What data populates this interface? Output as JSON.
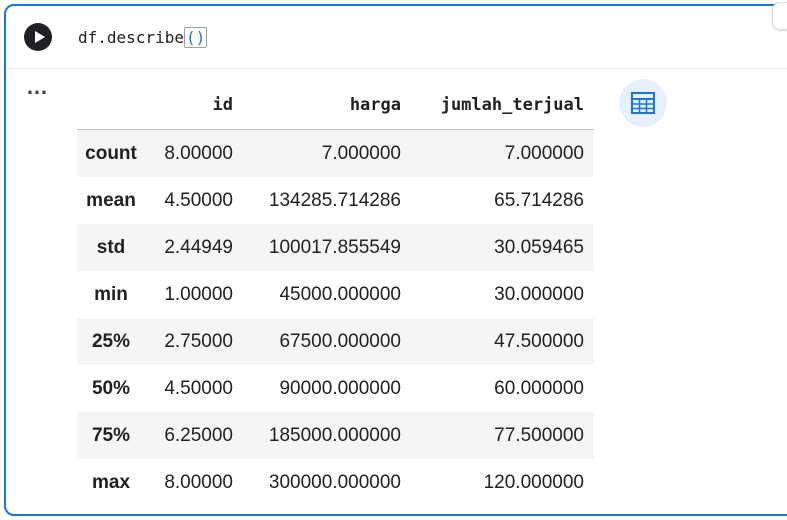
{
  "code_cell": {
    "code_prefix": "df.describe",
    "code_parens": "()",
    "run_icon": "play-icon",
    "output_menu_icon": "more-horiz-icon"
  },
  "dataframe": {
    "columns": [
      "",
      "id",
      "harga",
      "jumlah_terjual"
    ],
    "rows": [
      {
        "label": "count",
        "id": "8.00000",
        "harga": "7.000000",
        "jumlah_terjual": "7.000000"
      },
      {
        "label": "mean",
        "id": "4.50000",
        "harga": "134285.714286",
        "jumlah_terjual": "65.714286"
      },
      {
        "label": "std",
        "id": "2.44949",
        "harga": "100017.855549",
        "jumlah_terjual": "30.059465"
      },
      {
        "label": "min",
        "id": "1.00000",
        "harga": "45000.000000",
        "jumlah_terjual": "30.000000"
      },
      {
        "label": "25%",
        "id": "2.75000",
        "harga": "67500.000000",
        "jumlah_terjual": "47.500000"
      },
      {
        "label": "50%",
        "id": "4.50000",
        "harga": "90000.000000",
        "jumlah_terjual": "60.000000"
      },
      {
        "label": "75%",
        "id": "6.25000",
        "harga": "185000.000000",
        "jumlah_terjual": "77.500000"
      },
      {
        "label": "max",
        "id": "8.00000",
        "harga": "300000.000000",
        "jumlah_terjual": "120.000000"
      }
    ]
  },
  "interactive_table_button": {
    "icon": "table-chart-icon"
  },
  "colors": {
    "accent": "#1a73e8",
    "row_stripe": "#f5f5f5",
    "chart_button_bg": "#e8f0fe"
  }
}
